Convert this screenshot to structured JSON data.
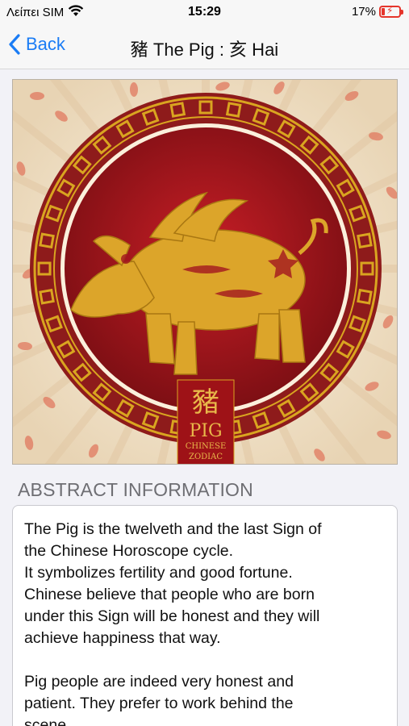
{
  "status_bar": {
    "carrier": "Λείπει SIM",
    "time": "15:29",
    "battery_percent": "17%",
    "wifi_icon": "wifi-icon",
    "battery_icon": "battery-charging-icon",
    "battery_level": 0.17
  },
  "nav": {
    "back_label": "Back",
    "title": "豬 The Pig : 亥 Hai"
  },
  "image": {
    "badge_char": "豬",
    "badge_title": "PIG",
    "badge_sub1": "CHINESE",
    "badge_sub2": "ZODIAC",
    "colors": {
      "background": "#f1e4cf",
      "ring_red": "#8e1b1b",
      "gold": "#d9a520",
      "inner_red": "#a3171f"
    }
  },
  "section": {
    "header": "ABSTRACT INFORMATION"
  },
  "abstract": {
    "paragraph1": "The Pig is the twelveth and the last Sign of\nthe Chinese Horoscope cycle.\nIt symbolizes fertility and good fortune.\nChinese believe that people who are born\nunder this Sign will be honest and they will\nachieve happiness that way.",
    "paragraph2": "Pig people are indeed very honest and\npatient. They prefer to work behind the\nscene."
  },
  "colors": {
    "accent": "#1a7cf5",
    "battery_low": "#e5352b"
  }
}
